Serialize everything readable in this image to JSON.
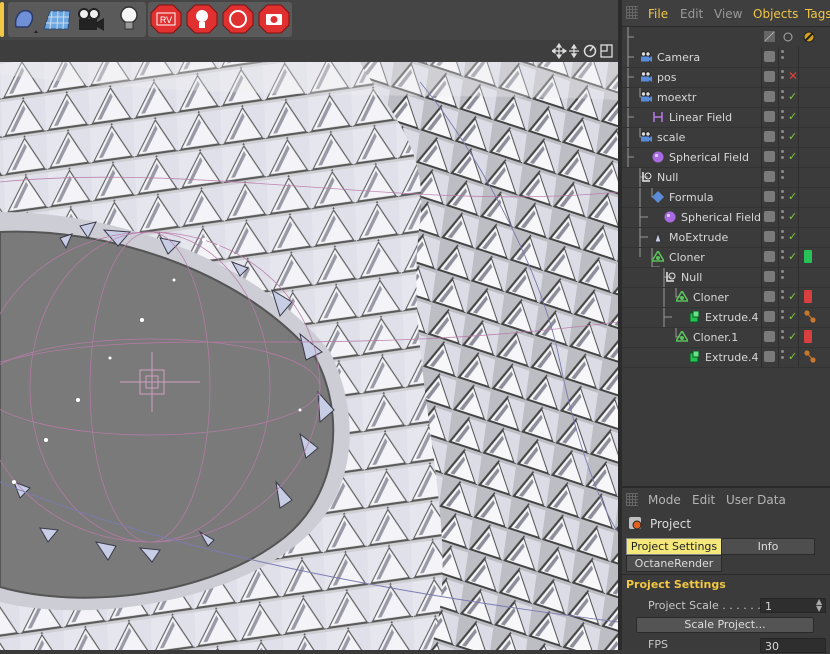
{
  "toolbar": {
    "tools": [
      "deformer-icon",
      "floor-icon",
      "camera-icon",
      "light-icon",
      "render-view-icon",
      "render-light-icon",
      "render-object-icon",
      "render-camera-icon"
    ],
    "render_view_label": "RV"
  },
  "object_manager": {
    "menu": [
      {
        "label": "File",
        "highlight": true
      },
      {
        "label": "Edit",
        "highlight": false
      },
      {
        "label": "View",
        "highlight": false
      },
      {
        "label": "Objects",
        "highlight": true
      },
      {
        "label": "Tags",
        "highlight": true
      }
    ],
    "objects": [
      {
        "name": "Camera",
        "icon": "camera-icon"
      },
      {
        "name": "pos",
        "icon": "camera-icon",
        "status": "x"
      },
      {
        "name": "moextr",
        "icon": "camera-icon",
        "status": "check"
      },
      {
        "name": "Linear Field",
        "icon": "linear-field-icon",
        "status": "check"
      },
      {
        "name": "scale",
        "icon": "camera-icon",
        "status": "check"
      },
      {
        "name": "Spherical Field",
        "icon": "spherical-field-icon",
        "status": "check"
      },
      {
        "name": "Null",
        "icon": "null-icon"
      },
      {
        "name": "Formula",
        "icon": "formula-icon",
        "status": "check"
      },
      {
        "name": "Spherical Field",
        "icon": "spherical-field-icon",
        "status": "check"
      },
      {
        "name": "MoExtrude",
        "icon": "moextrude-icon",
        "status": "check"
      },
      {
        "name": "Cloner",
        "icon": "cloner-icon",
        "status": "check",
        "tag": "#27c256"
      },
      {
        "name": "Null",
        "icon": "null-icon"
      },
      {
        "name": "Cloner",
        "icon": "cloner-icon",
        "status": "check",
        "tag": "#d84040"
      },
      {
        "name": "Extrude.4",
        "icon": "extrude-icon",
        "status": "check",
        "tag": "phong"
      },
      {
        "name": "Cloner.1",
        "icon": "cloner-icon",
        "status": "check",
        "tag": "#d84040"
      },
      {
        "name": "Extrude.4",
        "icon": "extrude-icon",
        "status": "check",
        "tag": "phong"
      }
    ]
  },
  "attribute_manager": {
    "menu": [
      "Mode",
      "Edit",
      "User Data"
    ],
    "title": "Project",
    "tabs": [
      {
        "label": "Project Settings",
        "active": true
      },
      {
        "label": "Info",
        "active": false
      },
      {
        "label": "OctaneRender",
        "active": false
      }
    ],
    "section": "Project Settings",
    "fields": {
      "project_scale_label": "Project Scale . . . . . . .",
      "project_scale_value": "1",
      "scale_project_button": "Scale Project...",
      "fps_label": "FPS",
      "fps_value": "30"
    }
  },
  "colors": {
    "accent": "#f2c744",
    "check": "#7fcc3a",
    "active_tab": "#f5e87a"
  }
}
